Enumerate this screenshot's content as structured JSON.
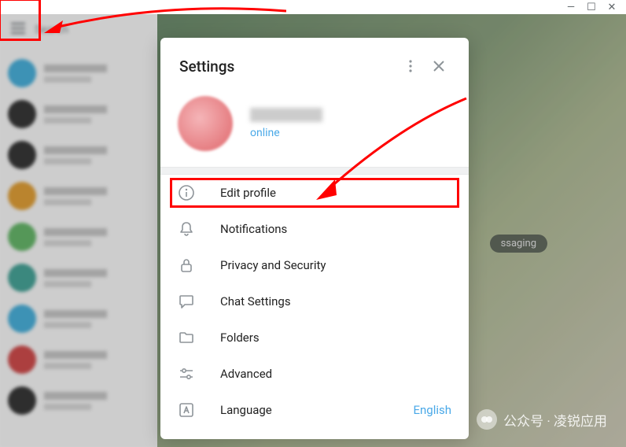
{
  "window": {
    "minimize": "—",
    "maximize": "☐",
    "close": "✕"
  },
  "sidebar": {
    "search_placeholder": "Search"
  },
  "main": {
    "messaging_text": "ssaging"
  },
  "settings": {
    "title": "Settings",
    "profile": {
      "status": "online"
    },
    "items": [
      {
        "label": "Edit profile",
        "icon": "info"
      },
      {
        "label": "Notifications",
        "icon": "bell"
      },
      {
        "label": "Privacy and Security",
        "icon": "lock"
      },
      {
        "label": "Chat Settings",
        "icon": "chat"
      },
      {
        "label": "Folders",
        "icon": "folder"
      },
      {
        "label": "Advanced",
        "icon": "sliders"
      },
      {
        "label": "Language",
        "icon": "language",
        "value": "English"
      }
    ]
  },
  "watermark": {
    "text": "公众号 · 凌锐应用"
  }
}
